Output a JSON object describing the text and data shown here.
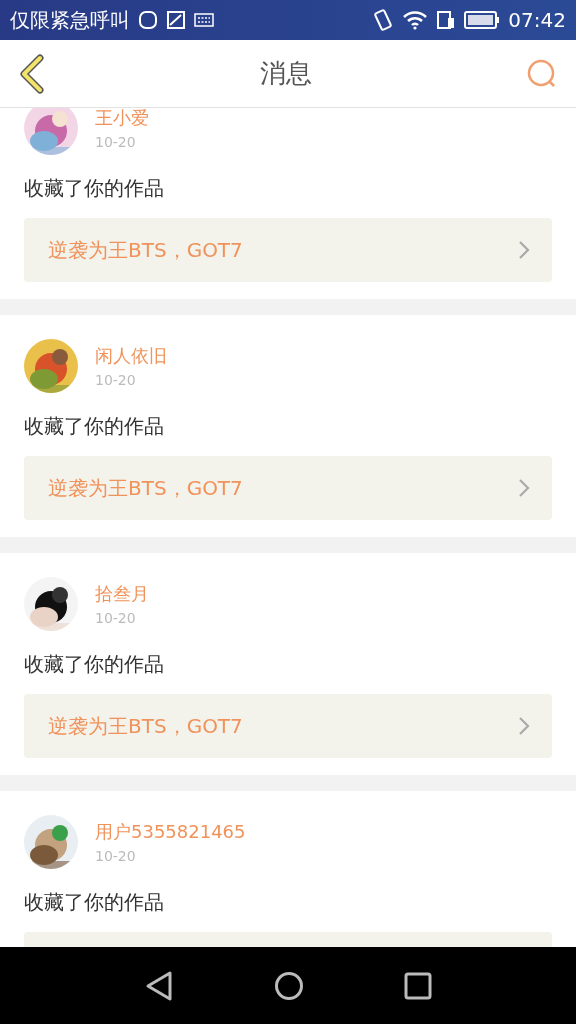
{
  "status_bar": {
    "carrier": "仅限紧急呼叫",
    "time": "07:42"
  },
  "header": {
    "title": "消息"
  },
  "messages": [
    {
      "user": "王小爱",
      "date": "10-20",
      "action": "收藏了你的作品",
      "work": "逆袭为王BTS，GOT7"
    },
    {
      "user": "闲人依旧",
      "date": "10-20",
      "action": "收藏了你的作品",
      "work": "逆袭为王BTS，GOT7"
    },
    {
      "user": "拾叁月",
      "date": "10-20",
      "action": "收藏了你的作品",
      "work": "逆袭为王BTS，GOT7"
    },
    {
      "user": "用户5355821465",
      "date": "10-20",
      "action": "收藏了你的作品"
    }
  ]
}
